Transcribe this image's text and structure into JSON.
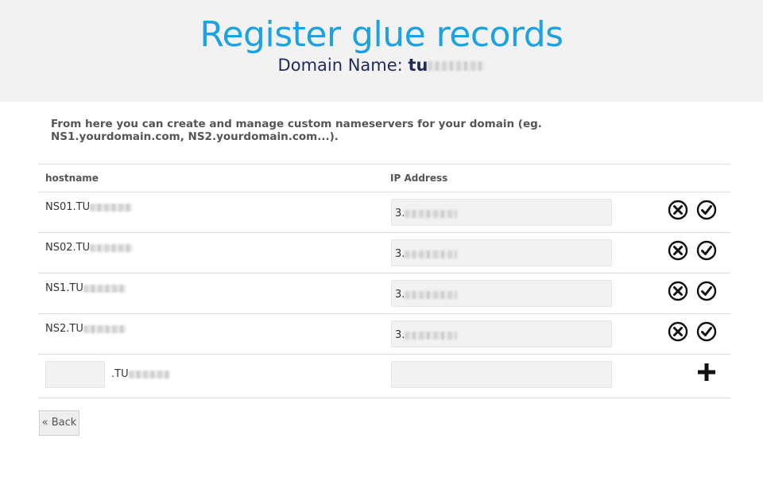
{
  "header": {
    "title": "Register glue records",
    "domain_label": "Domain Name:",
    "domain_value": "tu"
  },
  "intro": "From here you can create and manage custom nameservers for your domain (eg. NS1.yourdomain.com, NS2.yourdomain.com...).",
  "table": {
    "columns": [
      "hostname",
      "IP Address"
    ],
    "rows": [
      {
        "hostname": "NS01.TU",
        "ip": "3."
      },
      {
        "hostname": "NS02.TU",
        "ip": "3."
      },
      {
        "hostname": "NS1.TU",
        "ip": "3."
      },
      {
        "hostname": "NS2.TU",
        "ip": "3."
      }
    ],
    "new_row": {
      "suffix": ".TU",
      "subdomain_value": "",
      "ip_value": ""
    }
  },
  "icons": {
    "delete": "delete-circle-icon",
    "save": "check-circle-icon",
    "add": "plus-icon"
  },
  "back_label": "« Back"
}
